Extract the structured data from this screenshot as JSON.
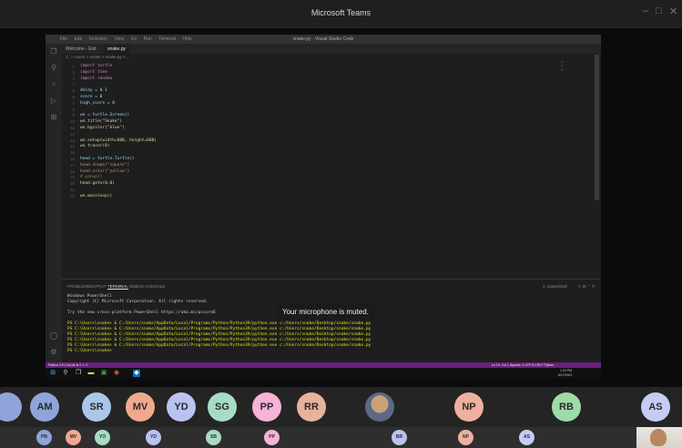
{
  "teams": {
    "window_title": "Microsoft Teams",
    "minimize": "–",
    "maximize": "□",
    "close": "✕"
  },
  "vscode": {
    "menu": [
      "File",
      "Edit",
      "Selection",
      "View",
      "Go",
      "Run",
      "Terminal",
      "Help"
    ],
    "title": "snake.py - Visual Studio Code",
    "tabs": [
      "Welcome - Exit",
      "snake.py"
    ],
    "breadcrumb": "C: > Users > snake > snake.py > ...",
    "code_lines": [
      {
        "n": "1",
        "t": "import turtle",
        "c": "#c586c0"
      },
      {
        "n": "2",
        "t": "import time",
        "c": "#c586c0"
      },
      {
        "n": "3",
        "t": "import random",
        "c": "#c586c0"
      },
      {
        "n": "4",
        "t": "",
        "c": "#ccc"
      },
      {
        "n": "5",
        "t": "delay = 0.1",
        "c": "#9cdcfe"
      },
      {
        "n": "6",
        "t": "score = 0",
        "c": "#9cdcfe"
      },
      {
        "n": "7",
        "t": "high_score = 0",
        "c": "#9cdcfe"
      },
      {
        "n": "8",
        "t": "",
        "c": "#ccc"
      },
      {
        "n": "9",
        "t": "wn = turtle.Screen()",
        "c": "#9cdcfe"
      },
      {
        "n": "10",
        "t": "wn.title(\"Snake\")",
        "c": "#dcdcaa"
      },
      {
        "n": "11",
        "t": "wn.bgcolor(\"blue\")",
        "c": "#dcdcaa"
      },
      {
        "n": "12",
        "t": "",
        "c": "#ccc"
      },
      {
        "n": "13",
        "t": "wn.setup(width=600, height=600)",
        "c": "#dcdcaa"
      },
      {
        "n": "14",
        "t": "wn.tracer(0)",
        "c": "#dcdcaa"
      },
      {
        "n": "15",
        "t": "",
        "c": "#ccc"
      },
      {
        "n": "16",
        "t": "head = turtle.Turtle()",
        "c": "#9cdcfe"
      },
      {
        "n": "17",
        "t": "head.shape(\"square\")",
        "c": "#ce9178"
      },
      {
        "n": "18",
        "t": "head.color(\"yellow\")",
        "c": "#ce9178"
      },
      {
        "n": "19",
        "t": "# penup()",
        "c": "#6a9955"
      },
      {
        "n": "20",
        "t": "head.goto(0,0)",
        "c": "#dcdcaa"
      },
      {
        "n": "21",
        "t": "",
        "c": "#ccc"
      },
      {
        "n": "22",
        "t": "wn.mainloop()",
        "c": "#dcdcaa"
      }
    ],
    "panel_tabs": [
      "PROBLEMS",
      "OUTPUT",
      "TERMINAL",
      "DEBUG CONSOLE"
    ],
    "terminal_lines": [
      "Windows PowerShell",
      "Copyright (C) Microsoft Corporation. All rights reserved.",
      "",
      "Try the new cross-platform PowerShell https://aka.ms/pscore6",
      "",
      "PS C:\\Users\\snake> & C:/Users/snake/AppData/Local/Programs/Python/Python39/python.exe c:/Users/snake/Desktop/snake/snake.py",
      "PS C:\\Users\\snake> & C:/Users/snake/AppData/Local/Programs/Python/Python39/python.exe c:/Users/snake/Desktop/snake/snake.py",
      "PS C:\\Users\\snake> & C:/Users/snake/AppData/Local/Programs/Python/Python39/python.exe c:/Users/snake/Desktop/snake/snake.py",
      "PS C:\\Users\\snake> & C:/Users/snake/AppData/Local/Programs/Python/Python39/python.exe c:/Users/snake/Desktop/snake/snake.py",
      "PS C:\\Users\\snake> & C:/Users/snake/AppData/Local/Programs/Python/Python39/python.exe c:/Users/snake/Desktop/snake/snake.py",
      "PS C:\\Users\\snake> "
    ],
    "panel_right": "1: powershell",
    "status_left": "Python 3.9.2 64-bit   ⊗ 0 ⚠ 0",
    "status_right": "Ln 19, Col 1   Spaces: 4   UTF-8   CRLF   Python",
    "taskbar_time": "1:20 PM",
    "taskbar_date": "5/27/2021"
  },
  "toast": {
    "text": "Your microphone is muted."
  },
  "participants": [
    "AM",
    "SR",
    "MV",
    "YD",
    "SG",
    "PP",
    "RR",
    "NP",
    "RB",
    "AS"
  ],
  "bottom_row": [
    "PB",
    "MV",
    "YO",
    "YD",
    "SB",
    "PP",
    "BR",
    "NP",
    "AS"
  ]
}
